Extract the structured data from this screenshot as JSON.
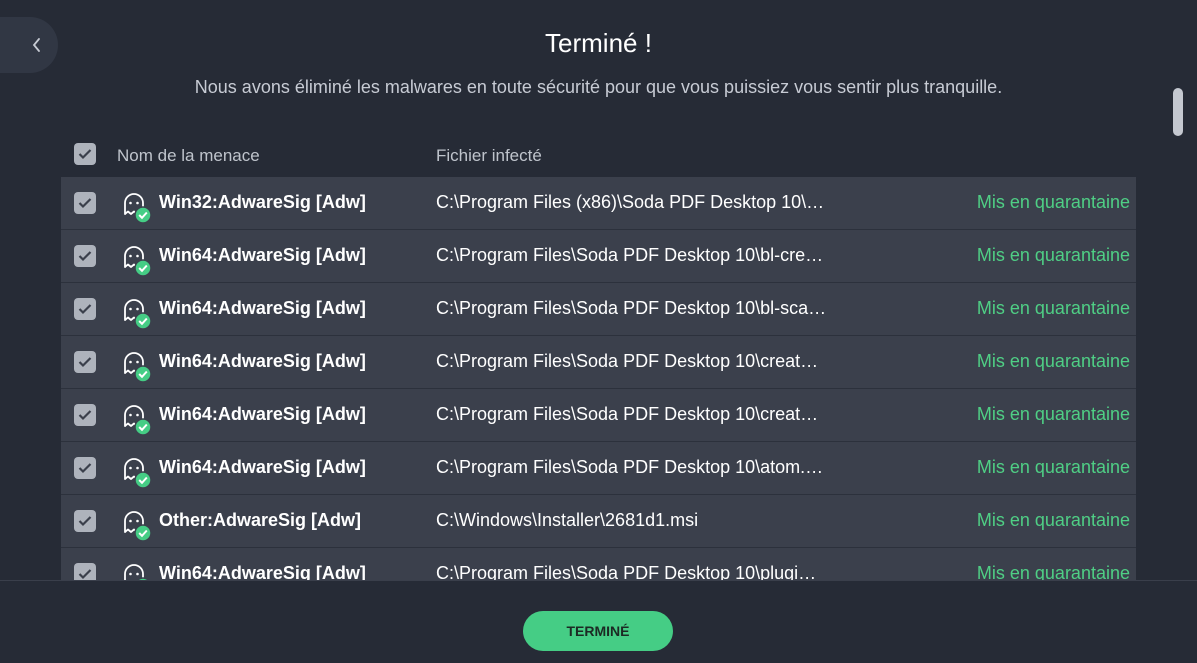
{
  "header": {
    "title": "Terminé !",
    "subtitle": "Nous avons éliminé les malwares en toute sécurité pour que vous puissiez vous sentir plus tranquille."
  },
  "table": {
    "columns": {
      "threat": "Nom de la menace",
      "file": "Fichier infecté"
    },
    "rows": [
      {
        "threat": "Win32:AdwareSig [Adw]",
        "file": "C:\\Program Files (x86)\\Soda PDF Desktop 10\\…",
        "status": "Mis en quarantaine",
        "checked": true
      },
      {
        "threat": "Win64:AdwareSig [Adw]",
        "file": "C:\\Program Files\\Soda PDF Desktop 10\\bl-cre…",
        "status": "Mis en quarantaine",
        "checked": true
      },
      {
        "threat": "Win64:AdwareSig [Adw]",
        "file": "C:\\Program Files\\Soda PDF Desktop 10\\bl-sca…",
        "status": "Mis en quarantaine",
        "checked": true
      },
      {
        "threat": "Win64:AdwareSig [Adw]",
        "file": "C:\\Program Files\\Soda PDF Desktop 10\\creat…",
        "status": "Mis en quarantaine",
        "checked": true
      },
      {
        "threat": "Win64:AdwareSig [Adw]",
        "file": "C:\\Program Files\\Soda PDF Desktop 10\\creat…",
        "status": "Mis en quarantaine",
        "checked": true
      },
      {
        "threat": "Win64:AdwareSig [Adw]",
        "file": "C:\\Program Files\\Soda PDF Desktop 10\\atom.…",
        "status": "Mis en quarantaine",
        "checked": true
      },
      {
        "threat": "Other:AdwareSig [Adw]",
        "file": "C:\\Windows\\Installer\\2681d1.msi",
        "status": "Mis en quarantaine",
        "checked": true
      },
      {
        "threat": "Win64:AdwareSig [Adw]",
        "file": "C:\\Program Files\\Soda PDF Desktop 10\\plugi…",
        "status": "Mis en quarantaine",
        "checked": true
      }
    ]
  },
  "footer": {
    "done_label": "TERMINÉ"
  },
  "icons": {
    "back": "chevron-left-icon",
    "threat": "ghost-check-icon",
    "checkbox": "checkmark-icon"
  },
  "colors": {
    "background": "#262b36",
    "row": "#3b404c",
    "accent": "#45cd85",
    "status": "#4fcf85"
  }
}
